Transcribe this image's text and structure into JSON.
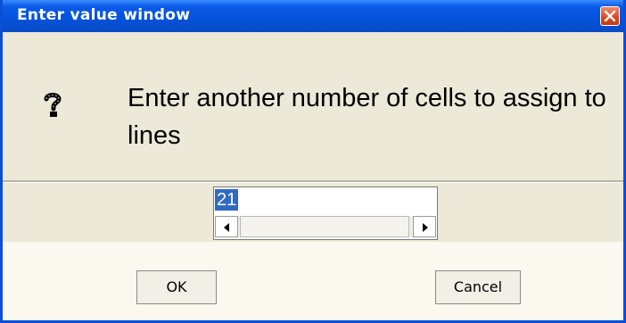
{
  "window": {
    "title": "Enter value window"
  },
  "dialog": {
    "message": "Enter another number of cells to assign to lines",
    "icon": "question-icon"
  },
  "input": {
    "value": "21"
  },
  "buttons": {
    "ok_label": "OK",
    "cancel_label": "Cancel"
  },
  "colors": {
    "titlebar": "#0552db",
    "dialog_bg": "#ece9d8",
    "selection": "#316ac5",
    "close_button": "#d9461f"
  }
}
